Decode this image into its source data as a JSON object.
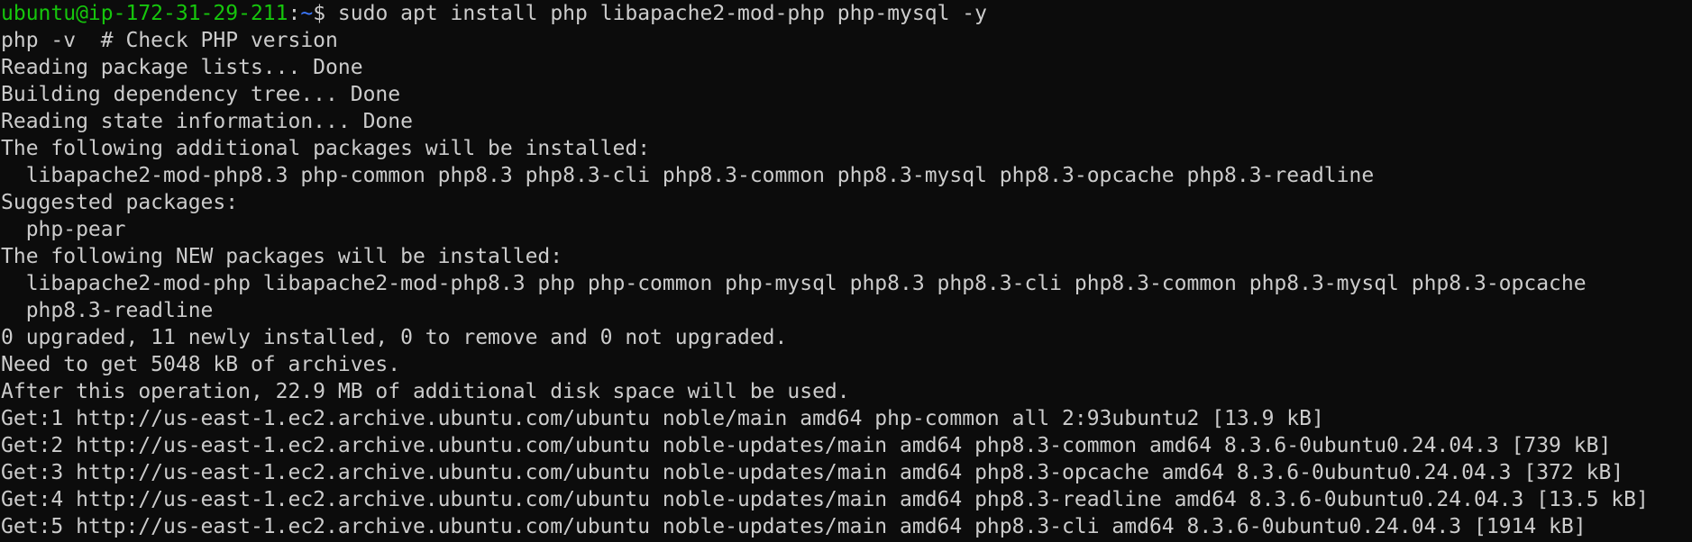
{
  "prompt": {
    "user_host": "ubuntu@ip-172-31-29-211",
    "colon": ":",
    "path": "~",
    "symbol": "$",
    "command": " sudo apt install php libapache2-mod-php php-mysql -y"
  },
  "colors": {
    "background": "#0c0c0c",
    "text": "#cccccc",
    "user_host": "#16c60c",
    "path": "#3b78ff"
  },
  "output_lines": [
    "php -v  # Check PHP version",
    "Reading package lists... Done",
    "Building dependency tree... Done",
    "Reading state information... Done",
    "The following additional packages will be installed:",
    "  libapache2-mod-php8.3 php-common php8.3 php8.3-cli php8.3-common php8.3-mysql php8.3-opcache php8.3-readline",
    "Suggested packages:",
    "  php-pear",
    "The following NEW packages will be installed:",
    "  libapache2-mod-php libapache2-mod-php8.3 php php-common php-mysql php8.3 php8.3-cli php8.3-common php8.3-mysql php8.3-opcache",
    "  php8.3-readline",
    "0 upgraded, 11 newly installed, 0 to remove and 0 not upgraded.",
    "Need to get 5048 kB of archives.",
    "After this operation, 22.9 MB of additional disk space will be used.",
    "Get:1 http://us-east-1.ec2.archive.ubuntu.com/ubuntu noble/main amd64 php-common all 2:93ubuntu2 [13.9 kB]",
    "Get:2 http://us-east-1.ec2.archive.ubuntu.com/ubuntu noble-updates/main amd64 php8.3-common amd64 8.3.6-0ubuntu0.24.04.3 [739 kB]",
    "Get:3 http://us-east-1.ec2.archive.ubuntu.com/ubuntu noble-updates/main amd64 php8.3-opcache amd64 8.3.6-0ubuntu0.24.04.3 [372 kB]",
    "Get:4 http://us-east-1.ec2.archive.ubuntu.com/ubuntu noble-updates/main amd64 php8.3-readline amd64 8.3.6-0ubuntu0.24.04.3 [13.5 kB]",
    "Get:5 http://us-east-1.ec2.archive.ubuntu.com/ubuntu noble-updates/main amd64 php8.3-cli amd64 8.3.6-0ubuntu0.24.04.3 [1914 kB]"
  ]
}
